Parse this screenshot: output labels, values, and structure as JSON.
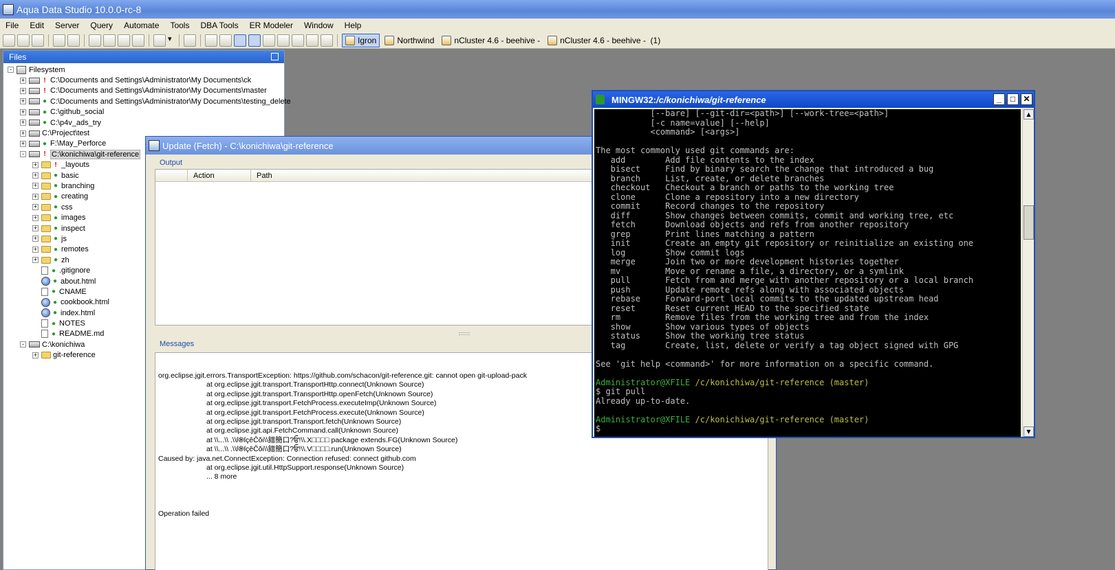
{
  "app": {
    "title": "Aqua Data Studio 10.0.0-rc-8"
  },
  "menu": [
    "File",
    "Edit",
    "Server",
    "Query",
    "Automate",
    "Tools",
    "DBA Tools",
    "ER Modeler",
    "Window",
    "Help"
  ],
  "connections": [
    "Igron",
    "Northwind",
    "nCluster 4.6 - beehive -",
    "nCluster 4.6 - beehive -  (1)"
  ],
  "files_panel": {
    "title": "Files",
    "tree": [
      {
        "label": "Filesystem",
        "level": 0,
        "toggle": "-",
        "icon": "root",
        "status": ""
      },
      {
        "label": "C:\\Documents and Settings\\Administrator\\My Documents\\ck",
        "level": 1,
        "toggle": "+",
        "icon": "drive",
        "status": "err"
      },
      {
        "label": "C:\\Documents and Settings\\Administrator\\My Documents\\master",
        "level": 1,
        "toggle": "+",
        "icon": "drive",
        "status": "err"
      },
      {
        "label": "C:\\Documents and Settings\\Administrator\\My Documents\\testing_delete",
        "level": 1,
        "toggle": "+",
        "icon": "drive",
        "status": "ok"
      },
      {
        "label": "C:\\github_social",
        "level": 1,
        "toggle": "+",
        "icon": "drive",
        "status": "ok"
      },
      {
        "label": "C:\\p4v_ads_try",
        "level": 1,
        "toggle": "+",
        "icon": "drive",
        "status": "ok"
      },
      {
        "label": "C:\\Project\\test",
        "level": 1,
        "toggle": "+",
        "icon": "drive",
        "status": ""
      },
      {
        "label": "F:\\May_Perforce",
        "level": 1,
        "toggle": "+",
        "icon": "drive",
        "status": "ok"
      },
      {
        "label": "C:\\konichiwa\\git-reference",
        "level": 1,
        "toggle": "-",
        "icon": "drive",
        "status": "err",
        "selected": true
      },
      {
        "label": "_layouts",
        "level": 2,
        "toggle": "+",
        "icon": "folder",
        "status": "err"
      },
      {
        "label": "basic",
        "level": 2,
        "toggle": "+",
        "icon": "folder",
        "status": "ok"
      },
      {
        "label": "branching",
        "level": 2,
        "toggle": "+",
        "icon": "folder",
        "status": "ok"
      },
      {
        "label": "creating",
        "level": 2,
        "toggle": "+",
        "icon": "folder",
        "status": "ok"
      },
      {
        "label": "css",
        "level": 2,
        "toggle": "+",
        "icon": "folder",
        "status": "ok"
      },
      {
        "label": "images",
        "level": 2,
        "toggle": "+",
        "icon": "folder",
        "status": "ok"
      },
      {
        "label": "inspect",
        "level": 2,
        "toggle": "+",
        "icon": "folder",
        "status": "ok"
      },
      {
        "label": "js",
        "level": 2,
        "toggle": "+",
        "icon": "folder",
        "status": "ok"
      },
      {
        "label": "remotes",
        "level": 2,
        "toggle": "+",
        "icon": "folder",
        "status": "ok"
      },
      {
        "label": "zh",
        "level": 2,
        "toggle": "+",
        "icon": "folder",
        "status": "ok"
      },
      {
        "label": ".gitignore",
        "level": 2,
        "toggle": "",
        "icon": "file",
        "status": "ok"
      },
      {
        "label": "about.html",
        "level": 2,
        "toggle": "",
        "icon": "html",
        "status": "ok"
      },
      {
        "label": "CNAME",
        "level": 2,
        "toggle": "",
        "icon": "file",
        "status": "ok"
      },
      {
        "label": "cookbook.html",
        "level": 2,
        "toggle": "",
        "icon": "html",
        "status": "ok"
      },
      {
        "label": "index.html",
        "level": 2,
        "toggle": "",
        "icon": "html",
        "status": "ok"
      },
      {
        "label": "NOTES",
        "level": 2,
        "toggle": "",
        "icon": "file",
        "status": "ok"
      },
      {
        "label": "README.md",
        "level": 2,
        "toggle": "",
        "icon": "file",
        "status": "ok"
      },
      {
        "label": "C:\\konichiwa",
        "level": 1,
        "toggle": "-",
        "icon": "drive",
        "status": ""
      },
      {
        "label": "git-reference",
        "level": 2,
        "toggle": "+",
        "icon": "folder",
        "status": ""
      }
    ]
  },
  "update_dialog": {
    "title": "Update (Fetch) - C:\\konichiwa\\git-reference",
    "output_label": "Output",
    "columns": [
      "",
      "Action",
      "Path"
    ],
    "messages_label": "Messages",
    "messages": [
      {
        "text": "org.eclipse.jgit.errors.TransportException: https://github.com/schacon/git-reference.git: cannot open git-upload-pack",
        "indent": false
      },
      {
        "text": "at org.eclipse.jgit.transport.TransportHttp.connect(Unknown Source)",
        "indent": true
      },
      {
        "text": "at org.eclipse.jgit.transport.TransportHttp.openFetch(Unknown Source)",
        "indent": true
      },
      {
        "text": "at org.eclipse.jgit.transport.FetchProcess.executeImp(Unknown Source)",
        "indent": true
      },
      {
        "text": "at org.eclipse.jgit.transport.FetchProcess.execute(Unknown Source)",
        "indent": true
      },
      {
        "text": "at org.eclipse.jgit.transport.Transport.fetch(Unknown Source)",
        "indent": true
      },
      {
        "text": "at org.eclipse.jgit.api.FetchCommand.call(Unknown Source)",
        "indent": true
      },
      {
        "text": "at \\\\...\\\\ .\\\\ſ֎ſçêČŏi\\\\錯簡口?ਓ!\\\\.X□□□□ package extends.FG(Unknown Source)",
        "indent": true
      },
      {
        "text": "at \\\\...\\\\ .\\\\ſ֎ſçêČŏi\\\\錯簡口?ਓ!\\\\.V□□□□.run(Unknown Source)",
        "indent": true
      },
      {
        "text": "Caused by: java.net.ConnectException: Connection refused: connect github.com",
        "indent": false
      },
      {
        "text": "at org.eclipse.jgit.util.HttpSupport.response(Unknown Source)",
        "indent": true
      },
      {
        "text": "... 8 more",
        "indent": true
      },
      {
        "text": "",
        "indent": false
      },
      {
        "text": "",
        "indent": false
      },
      {
        "text": "",
        "indent": false
      },
      {
        "text": "Operation failed",
        "indent": false
      }
    ]
  },
  "terminal": {
    "title_prefix": "MINGW32:",
    "title_path": "/c/konichiwa/git-reference",
    "lines": [
      {
        "text": "           [--bare] [--git-dir=<path>] [--work-tree=<path>]",
        "style": ""
      },
      {
        "text": "           [-c name=value] [--help]",
        "style": ""
      },
      {
        "text": "           <command> [<args>]",
        "style": ""
      },
      {
        "text": "",
        "style": ""
      },
      {
        "text": "The most commonly used git commands are:",
        "style": ""
      },
      {
        "text": "   add        Add file contents to the index",
        "style": ""
      },
      {
        "text": "   bisect     Find by binary search the change that introduced a bug",
        "style": ""
      },
      {
        "text": "   branch     List, create, or delete branches",
        "style": ""
      },
      {
        "text": "   checkout   Checkout a branch or paths to the working tree",
        "style": ""
      },
      {
        "text": "   clone      Clone a repository into a new directory",
        "style": ""
      },
      {
        "text": "   commit     Record changes to the repository",
        "style": ""
      },
      {
        "text": "   diff       Show changes between commits, commit and working tree, etc",
        "style": ""
      },
      {
        "text": "   fetch      Download objects and refs from another repository",
        "style": ""
      },
      {
        "text": "   grep       Print lines matching a pattern",
        "style": ""
      },
      {
        "text": "   init       Create an empty git repository or reinitialize an existing one",
        "style": ""
      },
      {
        "text": "   log        Show commit logs",
        "style": ""
      },
      {
        "text": "   merge      Join two or more development histories together",
        "style": ""
      },
      {
        "text": "   mv         Move or rename a file, a directory, or a symlink",
        "style": ""
      },
      {
        "text": "   pull       Fetch from and merge with another repository or a local branch",
        "style": ""
      },
      {
        "text": "   push       Update remote refs along with associated objects",
        "style": ""
      },
      {
        "text": "   rebase     Forward-port local commits to the updated upstream head",
        "style": ""
      },
      {
        "text": "   reset      Reset current HEAD to the specified state",
        "style": ""
      },
      {
        "text": "   rm         Remove files from the working tree and from the index",
        "style": ""
      },
      {
        "text": "   show       Show various types of objects",
        "style": ""
      },
      {
        "text": "   status     Show the working tree status",
        "style": ""
      },
      {
        "text": "   tag        Create, list, delete or verify a tag object signed with GPG",
        "style": ""
      },
      {
        "text": "",
        "style": ""
      },
      {
        "text": "See 'git help <command>' for more information on a specific command.",
        "style": ""
      },
      {
        "text": "",
        "style": ""
      },
      {
        "text": "",
        "style": "prompt",
        "user": "Administrator@XFILE",
        "path": "/c/konichiwa/git-reference (master)"
      },
      {
        "text": "$ git pull",
        "style": ""
      },
      {
        "text": "Already up-to-date.",
        "style": ""
      },
      {
        "text": "",
        "style": ""
      },
      {
        "text": "",
        "style": "prompt",
        "user": "Administrator@XFILE",
        "path": "/c/konichiwa/git-reference (master)"
      },
      {
        "text": "$",
        "style": ""
      }
    ]
  },
  "colors": {
    "titlebar": "#6f97e3",
    "prompt_user": "#3bb03b",
    "prompt_path": "#bfbf40",
    "status_ok": "#2a9a2a",
    "status_err": "#d00000"
  }
}
